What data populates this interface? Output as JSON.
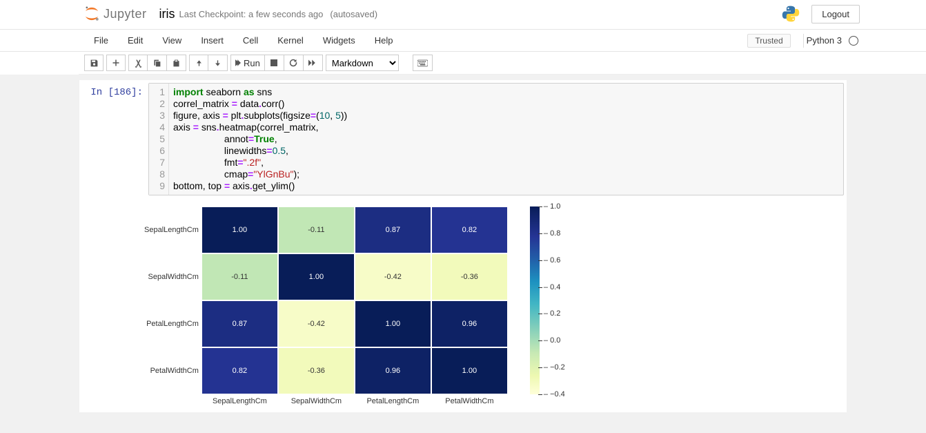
{
  "header": {
    "logo_text": "Jupyter",
    "notebook_name": "iris",
    "checkpoint": "Last Checkpoint: a few seconds ago",
    "autosave": "(autosaved)",
    "logout": "Logout"
  },
  "menu": {
    "items": [
      "File",
      "Edit",
      "View",
      "Insert",
      "Cell",
      "Kernel",
      "Widgets",
      "Help"
    ],
    "trusted": "Trusted",
    "kernel": "Python 3"
  },
  "toolbar": {
    "run_label": "Run",
    "cell_type": "Markdown"
  },
  "cell": {
    "prompt": "In [186]:",
    "code_lines": [
      {
        "n": "1",
        "tokens": [
          [
            "kw",
            "import"
          ],
          [
            "",
            " seaborn "
          ],
          [
            "kw",
            "as"
          ],
          [
            "",
            " sns"
          ]
        ]
      },
      {
        "n": "2",
        "tokens": [
          [
            "",
            "correl_matrix "
          ],
          [
            "op",
            "="
          ],
          [
            "",
            " data"
          ],
          [
            "op",
            "."
          ],
          [
            "",
            "corr()"
          ]
        ]
      },
      {
        "n": "3",
        "tokens": [
          [
            "",
            "figure, axis "
          ],
          [
            "op",
            "="
          ],
          [
            "",
            " plt"
          ],
          [
            "op",
            "."
          ],
          [
            "",
            "subplots(figsize"
          ],
          [
            "op",
            "="
          ],
          [
            "",
            "("
          ],
          [
            "num",
            "10"
          ],
          [
            "",
            ", "
          ],
          [
            "num",
            "5"
          ],
          [
            "",
            "))"
          ]
        ]
      },
      {
        "n": "4",
        "tokens": [
          [
            "",
            "axis "
          ],
          [
            "op",
            "="
          ],
          [
            "",
            " sns"
          ],
          [
            "op",
            "."
          ],
          [
            "",
            "heatmap(correl_matrix,"
          ]
        ]
      },
      {
        "n": "5",
        "tokens": [
          [
            "",
            "                   annot"
          ],
          [
            "op",
            "="
          ],
          [
            "bool",
            "True"
          ],
          [
            "",
            ","
          ]
        ]
      },
      {
        "n": "6",
        "tokens": [
          [
            "",
            "                   linewidths"
          ],
          [
            "op",
            "="
          ],
          [
            "num",
            "0.5"
          ],
          [
            "",
            ","
          ]
        ]
      },
      {
        "n": "7",
        "tokens": [
          [
            "",
            "                   fmt"
          ],
          [
            "op",
            "="
          ],
          [
            "str",
            "\".2f\""
          ],
          [
            "",
            ","
          ]
        ]
      },
      {
        "n": "8",
        "tokens": [
          [
            "",
            "                   cmap"
          ],
          [
            "op",
            "="
          ],
          [
            "str",
            "\"YlGnBu\""
          ],
          [
            "",
            ");"
          ]
        ]
      },
      {
        "n": "9",
        "tokens": [
          [
            "",
            "bottom, top "
          ],
          [
            "op",
            "="
          ],
          [
            "",
            " axis"
          ],
          [
            "op",
            "."
          ],
          [
            "",
            "get_ylim()"
          ]
        ]
      }
    ]
  },
  "chart_data": {
    "type": "heatmap",
    "title": "",
    "x_categories": [
      "SepalLengthCm",
      "SepalWidthCm",
      "PetalLengthCm",
      "PetalWidthCm"
    ],
    "y_categories": [
      "SepalLengthCm",
      "SepalWidthCm",
      "PetalLengthCm",
      "PetalWidthCm"
    ],
    "values": [
      [
        1.0,
        -0.11,
        0.87,
        0.82
      ],
      [
        -0.11,
        1.0,
        -0.42,
        -0.36
      ],
      [
        0.87,
        -0.42,
        1.0,
        0.96
      ],
      [
        0.82,
        -0.36,
        0.96,
        1.0
      ]
    ],
    "colormap": "YlGnBu",
    "value_range": [
      -0.4,
      1.0
    ],
    "colorbar_ticks": [
      1.0,
      0.8,
      0.6,
      0.4,
      0.2,
      0.0,
      -0.2,
      -0.4
    ]
  }
}
